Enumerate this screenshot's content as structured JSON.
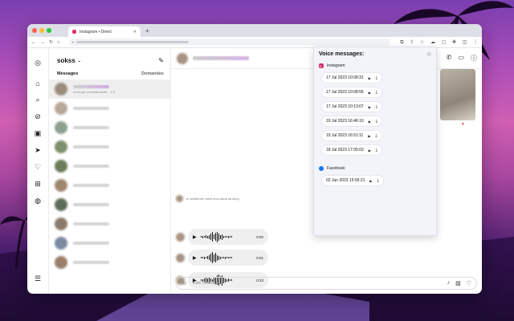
{
  "browser": {
    "tab_title": "Instagram • Direct",
    "new_tab": "+",
    "traffic_colors": [
      "#ff5f57",
      "#febc2e",
      "#28c840"
    ]
  },
  "icons": {
    "back": "←",
    "forward": "→",
    "reload": "↻",
    "home": "⌂",
    "rail": [
      "instagram-icon",
      "home-icon",
      "search-icon",
      "explore-icon",
      "reels-icon",
      "messages-icon",
      "heart-icon",
      "create-icon",
      "threads-icon"
    ]
  },
  "sidebar": {
    "username": "sokss",
    "messages_label": "Messages",
    "requests_label": "Demandes",
    "selected_preview": "a envoyé un extrait audio. · 2 h"
  },
  "chat": {
    "story_reply": "a mentionné votre nom dans sa story",
    "voice_messages": [
      {
        "duration": "0:02"
      },
      {
        "duration": "0:01"
      },
      {
        "duration": "0:23"
      }
    ],
    "composer_placeholder": "Votre message..."
  },
  "popup": {
    "title": "Voice messages:",
    "instagram_label": "Instagram:",
    "facebook_label": "Facebook:",
    "instagram_items": [
      "17 Jul 2023 10:08:31",
      "17 Jul 2023 10:08:55",
      "17 Jul 2023 10:13:07",
      "19 Jul 2023 16:46:10",
      "19 Jul 2023 16:51:11",
      "18 Jul 2023 17:05:03"
    ],
    "facebook_items": [
      "02 Jun 2023 15:55:21"
    ]
  },
  "colors": {
    "instagram_brand": "#e1306c",
    "facebook_brand": "#1877f2",
    "like_heart": "#e02a3b"
  }
}
